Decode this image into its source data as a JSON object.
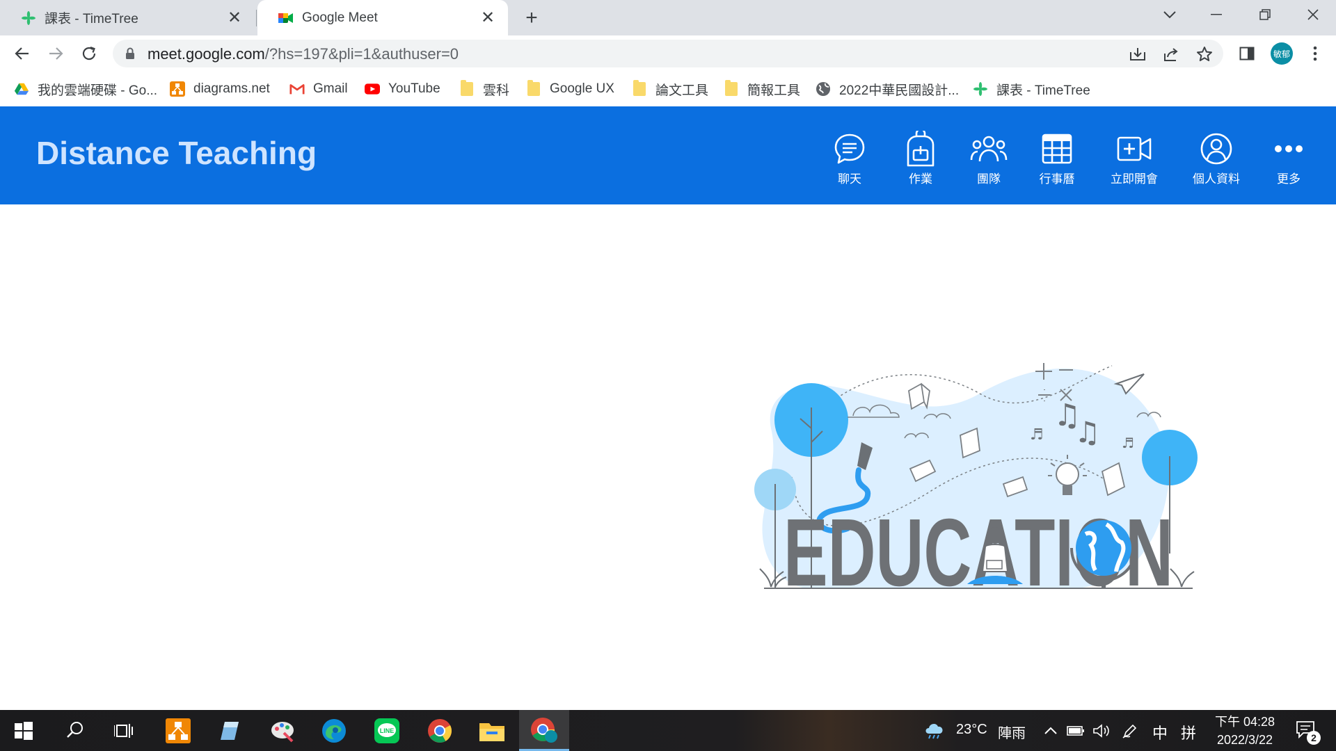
{
  "browser": {
    "tabs": [
      {
        "title": "課表 - TimeTree",
        "favicon": "timetree-icon"
      },
      {
        "title": "Google Meet",
        "favicon": "google-meet-icon",
        "active": true
      }
    ],
    "url": {
      "domain": "meet.google.com",
      "path": "/?hs=197&pli=1&authuser=0"
    },
    "profile_initials": "敏郁",
    "bookmarks": [
      {
        "label": "我的雲端硬碟 - Go...",
        "icon": "google-drive-icon"
      },
      {
        "label": "diagrams.net",
        "icon": "diagrams-icon"
      },
      {
        "label": "Gmail",
        "icon": "gmail-icon"
      },
      {
        "label": "YouTube",
        "icon": "youtube-icon"
      },
      {
        "label": "雲科",
        "icon": "folder-icon"
      },
      {
        "label": "Google UX",
        "icon": "folder-icon"
      },
      {
        "label": "論文工具",
        "icon": "folder-icon"
      },
      {
        "label": "簡報工具",
        "icon": "folder-icon"
      },
      {
        "label": "2022中華民國設計...",
        "icon": "globe-icon"
      },
      {
        "label": "課表 - TimeTree",
        "icon": "timetree-icon"
      }
    ]
  },
  "app": {
    "title": "Distance Teaching",
    "header_color": "#0b6fe0",
    "nav": [
      {
        "label": "聊天",
        "icon": "chat-icon"
      },
      {
        "label": "作業",
        "icon": "backpack-icon"
      },
      {
        "label": "團隊",
        "icon": "team-icon"
      },
      {
        "label": "行事曆",
        "icon": "calendar-icon"
      },
      {
        "label": "立即開會",
        "icon": "video-add-icon"
      },
      {
        "label": "個人資料",
        "icon": "profile-icon"
      },
      {
        "label": "更多",
        "icon": "more-icon"
      }
    ],
    "illustration_text": "EDUCATION"
  },
  "taskbar": {
    "weather": {
      "temp": "23°C",
      "condition": "陣雨"
    },
    "ime_mode": "中",
    "ime_layout": "拼",
    "time": "下午 04:28",
    "date": "2022/3/22",
    "notification_count": "2"
  }
}
